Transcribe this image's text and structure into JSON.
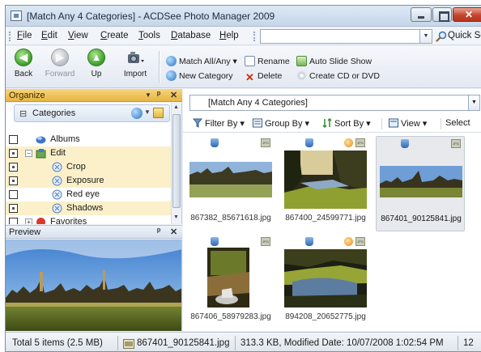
{
  "window": {
    "title": "[Match Any 4 Categories] - ACDSee Photo Manager 2009",
    "close_glyph": "✕"
  },
  "menu": {
    "items": [
      "File",
      "Edit",
      "View",
      "Create",
      "Tools",
      "Database",
      "Help"
    ],
    "search_value": "",
    "quick_search_label": "Quick Sea"
  },
  "toolbar": {
    "back": "Back",
    "forward": "Forward",
    "up": "Up",
    "import": "Import",
    "match": "Match All/Any",
    "new_category": "New Category",
    "rename": "Rename",
    "delete": "Delete",
    "auto_slide_show": "Auto Slide Show",
    "create_cd": "Create CD or DVD"
  },
  "organize": {
    "title": "Organize",
    "categories_title": "Categories",
    "rows": [
      {
        "label": "Albums",
        "level": 1,
        "icon": "albums-icon",
        "checked": false,
        "highlight": false
      },
      {
        "label": "Edit",
        "level": 1,
        "icon": "folder-icon",
        "checked": true,
        "highlight": true,
        "expanded": true
      },
      {
        "label": "Crop",
        "level": 2,
        "icon": "tag-icon",
        "checked": true,
        "highlight": true
      },
      {
        "label": "Exposure",
        "level": 2,
        "icon": "tag-icon",
        "checked": true,
        "highlight": true
      },
      {
        "label": "Red eye",
        "level": 2,
        "icon": "tag-icon",
        "checked": false,
        "highlight": false
      },
      {
        "label": "Shadows",
        "level": 2,
        "icon": "tag-icon",
        "checked": true,
        "highlight": true
      },
      {
        "label": "Favorites",
        "level": 1,
        "icon": "favorites-icon",
        "checked": false,
        "highlight": false
      }
    ]
  },
  "preview": {
    "title": "Preview"
  },
  "browser": {
    "path": "[Match Any 4 Categories]",
    "filter_by": "Filter By",
    "group_by": "Group By",
    "sort_by": "Sort By",
    "view": "View",
    "select": "Select",
    "files": [
      {
        "name": "867382_85671618.jpg",
        "selected": false,
        "edited": false
      },
      {
        "name": "867400_24599771.jpg",
        "selected": false,
        "edited": true
      },
      {
        "name": "867401_90125841.jpg",
        "selected": true,
        "edited": false
      },
      {
        "name": "867406_58979283.jpg",
        "selected": false,
        "edited": false
      },
      {
        "name": "894208_20652775.jpg",
        "selected": false,
        "edited": true
      }
    ]
  },
  "status": {
    "total": "Total 5 items  (2.5 MB)",
    "file": "867401_90125841.jpg",
    "info": "313.3 KB, Modified Date: 10/07/2008 1:02:54 PM",
    "extra": "12"
  },
  "colors": {
    "organize_header": "#e7b441",
    "category_highlight": "#fbf0c9",
    "selected_thumb": "#e7e9ed"
  }
}
